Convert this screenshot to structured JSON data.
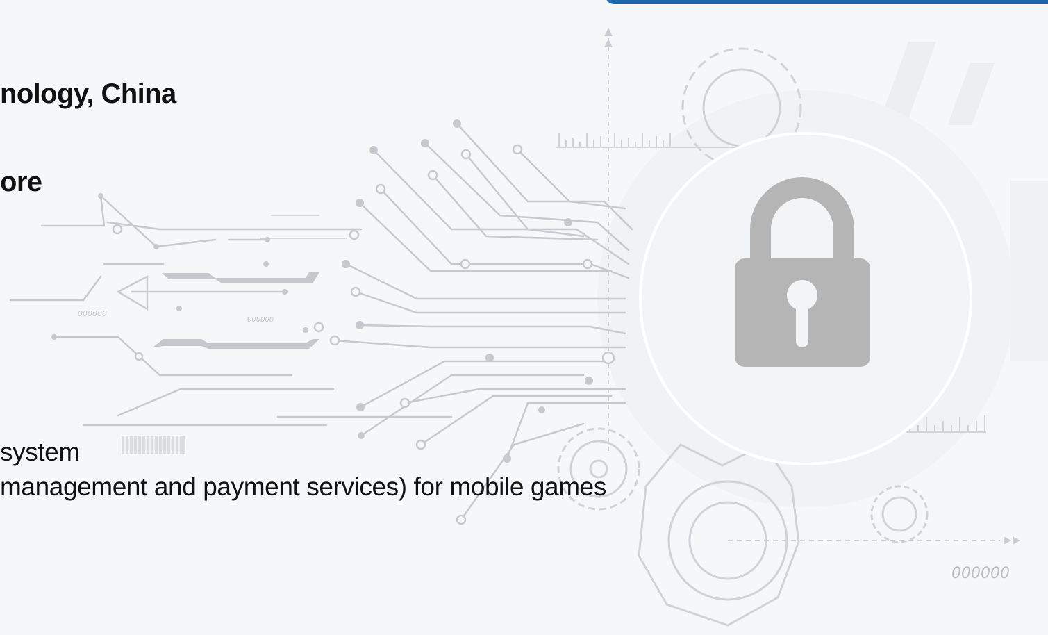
{
  "slide": {
    "lines": {
      "l1": "nology, China",
      "l2": "ore",
      "l3": "system",
      "l4": " management and payment services) for mobile games"
    },
    "deco_labels": {
      "bottom_right": "000000",
      "left_tag": "000000",
      "center_tag": "000000"
    }
  },
  "colors": {
    "accent": "#1a66b3",
    "lock": "#b5b5b5",
    "circuit": "#c9ccd1",
    "text": "#111111"
  },
  "icons": {
    "lock": "padlock-icon",
    "gear": "gear-icon"
  }
}
